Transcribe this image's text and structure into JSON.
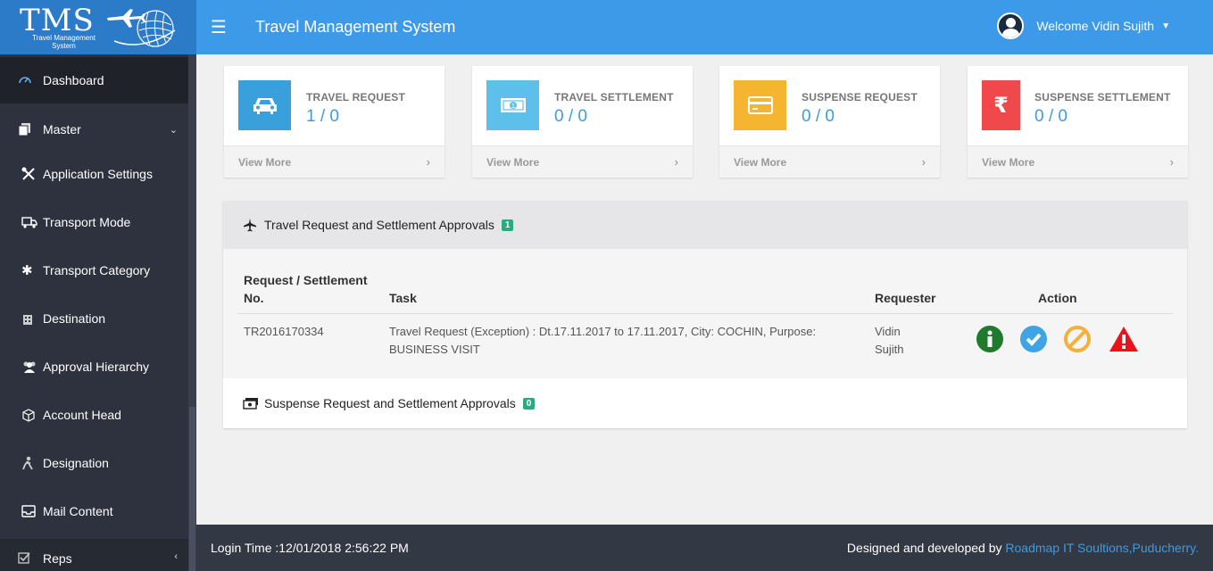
{
  "logo": {
    "title": "TMS",
    "subtitle_line1": "Travel Management",
    "subtitle_line2": "System"
  },
  "header": {
    "title": "Travel Management System",
    "welcome": "Welcome Vidin Sujith"
  },
  "sidebar": {
    "items": [
      {
        "label": "Dashboard",
        "icon": "dashboard-icon"
      },
      {
        "label": "Master",
        "icon": "copy-icon"
      },
      {
        "label": "Application Settings",
        "icon": "tools-icon"
      },
      {
        "label": "Transport Mode",
        "icon": "truck-icon"
      },
      {
        "label": "Transport Category",
        "icon": "snowflake-icon"
      },
      {
        "label": "Destination",
        "icon": "building-icon"
      },
      {
        "label": "Approval Hierarchy",
        "icon": "users-icon"
      },
      {
        "label": "Account Head",
        "icon": "cube-icon"
      },
      {
        "label": "Designation",
        "icon": "person-icon"
      },
      {
        "label": "Mail Content",
        "icon": "inbox-icon"
      },
      {
        "label": "Reps",
        "icon": "check-square-icon"
      }
    ]
  },
  "cards": [
    {
      "title": "TRAVEL REQUEST",
      "value": "1 / 0",
      "footer": "View More",
      "color": "#3aa0dc",
      "icon": "car-icon"
    },
    {
      "title": "TRAVEL SETTLEMENT",
      "value": "0 / 0",
      "footer": "View More",
      "color": "#5dc0ea",
      "icon": "money-icon"
    },
    {
      "title": "SUSPENSE REQUEST",
      "value": "0 / 0",
      "footer": "View More",
      "color": "#f5b530",
      "icon": "credit-card-icon"
    },
    {
      "title": "SUSPENSE SETTLEMENT",
      "value": "0 / 0",
      "footer": "View More",
      "color": "#f0494c",
      "icon": "rupee-icon"
    }
  ],
  "approvals": {
    "title": "Travel Request and Settlement Approvals",
    "count": "1",
    "columns": {
      "request_line1": "Request / Settlement",
      "request_line2": "No.",
      "task": "Task",
      "requester": "Requester",
      "action": "Action"
    },
    "rows": [
      {
        "number": "TR2016170334",
        "task_line1": "Travel Request (Exception) : Dt.17.11.2017 to 17.11.2017, City: COCHIN, Purpose:",
        "task_line2": "BUSINESS VISIT",
        "requester_line1": "Vidin",
        "requester_line2": "Sujith"
      }
    ]
  },
  "suspense": {
    "title": "Suspense Request and Settlement Approvals",
    "count": "0"
  },
  "footer": {
    "login_time": "Login Time :12/01/2018 2:56:22 PM",
    "designed_by": "Designed and developed by ",
    "company": "Roadmap IT Soultions,Puducherry."
  },
  "colors": {
    "accent": "#3c9ae8",
    "sidebar": "#2d323e",
    "badge": "#2bab7d"
  }
}
